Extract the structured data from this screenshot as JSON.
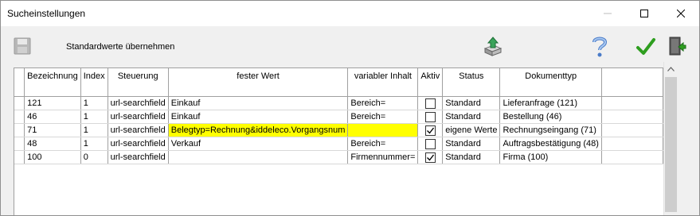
{
  "window": {
    "title": "Sucheinstellungen"
  },
  "toolbar": {
    "standard_label": "Standardwerte übernehmen",
    "icons": [
      "save-icon",
      "export-icon",
      "help-icon",
      "confirm-check-icon",
      "exit-door-icon"
    ]
  },
  "colors": {
    "highlight": "#ffff00",
    "confirm_green": "#2e9e1f"
  },
  "grid": {
    "columns": {
      "bezeichnung": "Bezeichnung",
      "index": "Index",
      "steuerung": "Steuerung",
      "fester_wert": "fester Wert",
      "variabler_inhalt": "variabler Inhalt",
      "aktiv": "Aktiv",
      "status": "Status",
      "dokumenttyp": "Dokumenttyp"
    },
    "rows": [
      {
        "bezeichnung": "121",
        "index": "1",
        "steuerung": "url-searchfield",
        "fester_wert": "Einkauf",
        "variabler_inhalt": "Bereich=",
        "aktiv": false,
        "status": "Standard",
        "dokumenttyp": "Lieferanfrage (121)"
      },
      {
        "bezeichnung": "46",
        "index": "1",
        "steuerung": "url-searchfield",
        "fester_wert": "Einkauf",
        "variabler_inhalt": "Bereich=",
        "aktiv": false,
        "status": "Standard",
        "dokumenttyp": "Bestellung (46)"
      },
      {
        "bezeichnung": "71",
        "index": "1",
        "steuerung": "url-searchfield",
        "fester_wert": "Belegtyp=Rechnung&iddeleco.Vorgangsnum",
        "variabler_inhalt": "",
        "aktiv": true,
        "status": "eigene Werte",
        "dokumenttyp": "Rechnungseingang (71)",
        "highlight": true
      },
      {
        "bezeichnung": "48",
        "index": "1",
        "steuerung": "url-searchfield",
        "fester_wert": "Verkauf",
        "variabler_inhalt": "Bereich=",
        "aktiv": false,
        "status": "Standard",
        "dokumenttyp": "Auftragsbestätigung (48)"
      },
      {
        "bezeichnung": "100",
        "index": "0",
        "steuerung": "url-searchfield",
        "fester_wert": "",
        "variabler_inhalt": "Firmennummer=",
        "aktiv": true,
        "status": "Standard",
        "dokumenttyp": "Firma (100)"
      }
    ]
  }
}
